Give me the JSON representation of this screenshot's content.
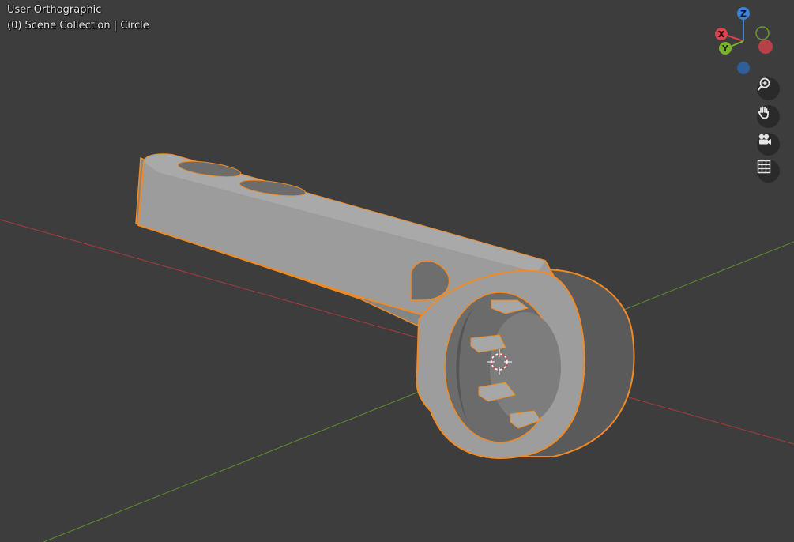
{
  "viewport": {
    "view_mode": "User Orthographic",
    "collection_info": "(0) Scene Collection | Circle",
    "background_color": "#3d3d3d",
    "x_axis_color": "#a83a3a",
    "y_axis_color": "#5c8a2c",
    "selection_outline_color": "#f08a24",
    "object_color": "#9b9b9b"
  },
  "gizmo": {
    "axes": [
      {
        "label": "X",
        "color": "#d6444f"
      },
      {
        "label": "Y",
        "color": "#7ab32b"
      },
      {
        "label": "Z",
        "color": "#3b82d8"
      }
    ]
  },
  "nav_buttons": [
    {
      "name": "zoom",
      "icon": "zoom-icon"
    },
    {
      "name": "pan",
      "icon": "hand-icon"
    },
    {
      "name": "camera",
      "icon": "camera-icon"
    },
    {
      "name": "grid",
      "icon": "grid-icon"
    }
  ]
}
